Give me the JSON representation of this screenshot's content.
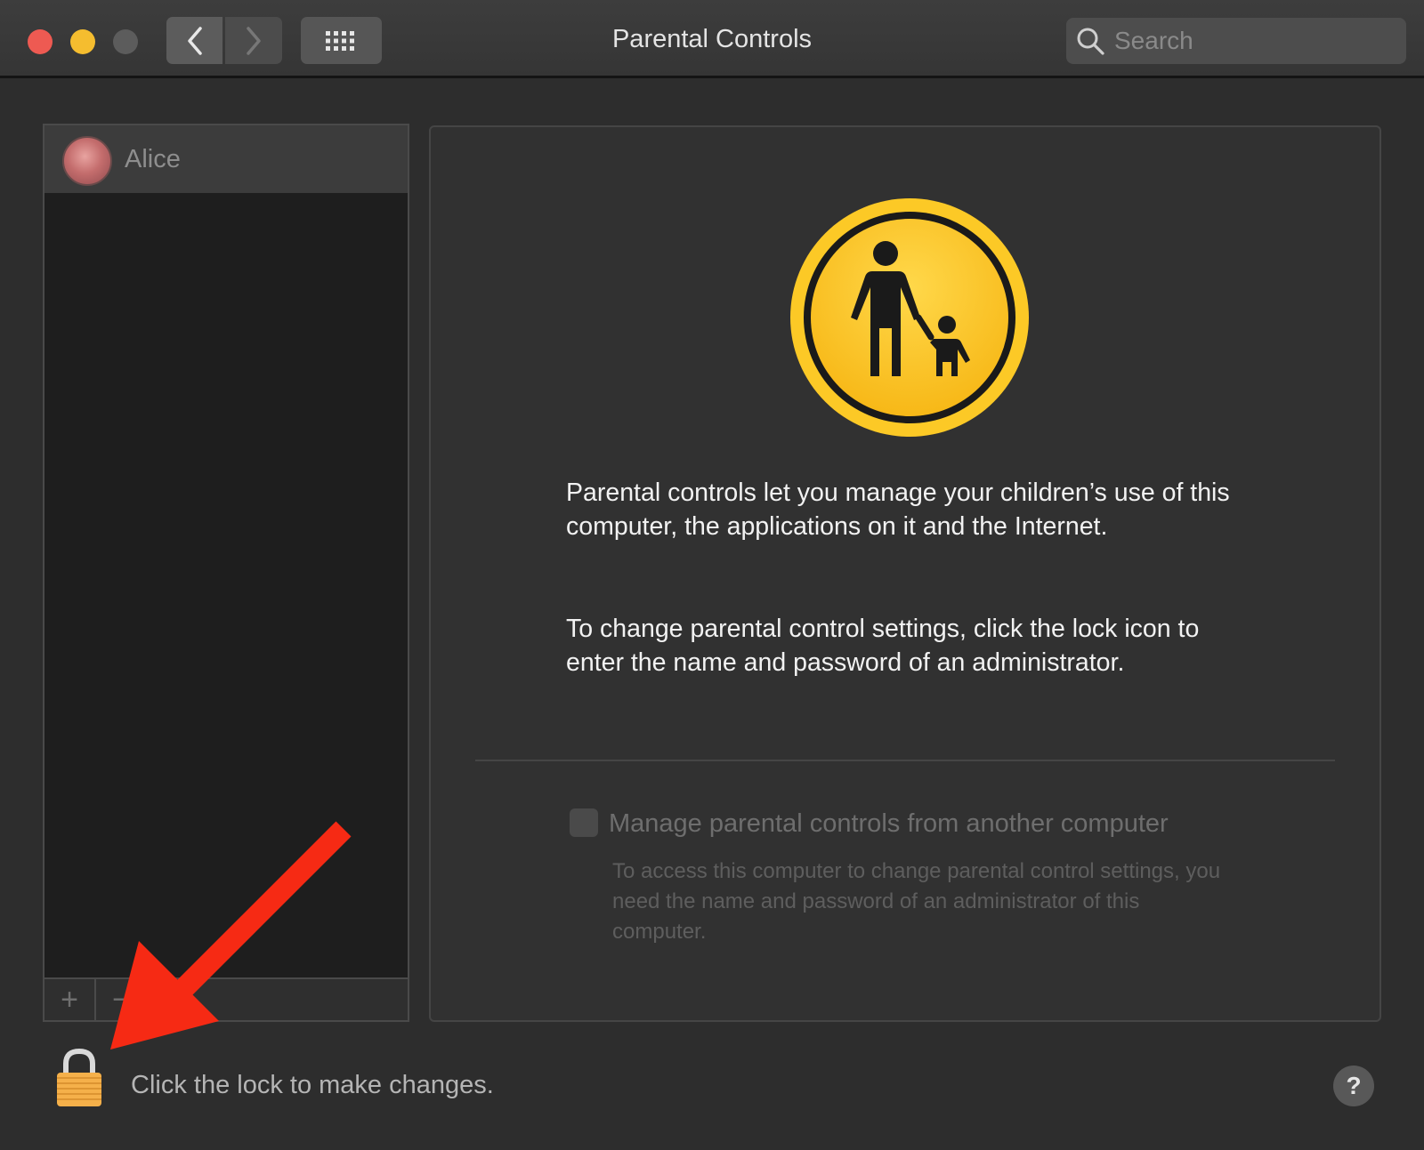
{
  "window": {
    "title": "Parental Controls"
  },
  "search": {
    "placeholder": "Search",
    "value": ""
  },
  "users": [
    {
      "name": "Alice"
    }
  ],
  "list_toolbar": {
    "add_label": "+",
    "remove_label": "−"
  },
  "content": {
    "info_paragraph_1": "Parental controls let you manage your children’s use of this computer, the applications on it and the Internet.",
    "info_paragraph_2": "To change parental control settings, click the lock icon to enter the name and password of an administrator.",
    "remote_checkbox": {
      "label": "Manage parental controls from another computer",
      "checked": false,
      "description": "To access this computer to change parental control settings, you need the name and password of an administrator of this computer."
    }
  },
  "footer": {
    "lock_label": "Click the lock to make changes.",
    "help_label": "?"
  },
  "colors": {
    "close": "#ee5a52",
    "minimize": "#f5bd2f",
    "zoom": "#5c5c5c",
    "icon_yellow": "#fcc926",
    "annotation_arrow": "#f62a14",
    "lock_body": "#f5b04a"
  },
  "icons": {
    "back": "chevron-left-icon",
    "forward": "chevron-right-icon",
    "show_all": "grid-icon",
    "search": "search-icon",
    "parental_controls": "parent-child-icon",
    "lock": "lock-icon",
    "help": "help-icon"
  }
}
